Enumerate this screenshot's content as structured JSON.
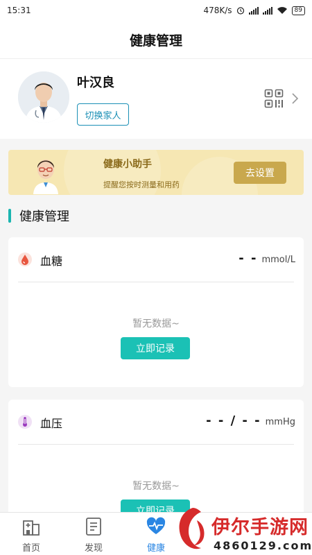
{
  "status_bar": {
    "time": "15:31",
    "net_speed": "478K/s",
    "battery": "89"
  },
  "header": {
    "title": "健康管理"
  },
  "profile": {
    "name": "叶汉良",
    "switch_label": "切换家人"
  },
  "assistant": {
    "title": "健康小助手",
    "subtitle": "提醒您按时测量和用药",
    "button": "去设置"
  },
  "section": {
    "title": "健康管理"
  },
  "cards": [
    {
      "title": "血糖",
      "value": "- -",
      "unit": "mmol/L",
      "empty_text": "暂无数据~",
      "button": "立即记录",
      "icon": "blood-drop-icon"
    },
    {
      "title": "血压",
      "value": "- - / - -",
      "unit": "mmHg",
      "empty_text": "暂无数据~",
      "button": "立即记录",
      "icon": "thermometer-icon"
    }
  ],
  "tabs": [
    {
      "label": "首页",
      "icon": "hospital-icon"
    },
    {
      "label": "发现",
      "icon": "document-icon"
    },
    {
      "label": "健康",
      "icon": "heart-pulse-icon",
      "active": true
    }
  ],
  "watermark": {
    "name": "伊尔手游网",
    "number": "4860129.com"
  },
  "colors": {
    "accent": "#1bc1b5",
    "primary_blue": "#2a86e3",
    "assistant_bg": "#f6e7b3",
    "assistant_btn": "#c9a84d"
  }
}
